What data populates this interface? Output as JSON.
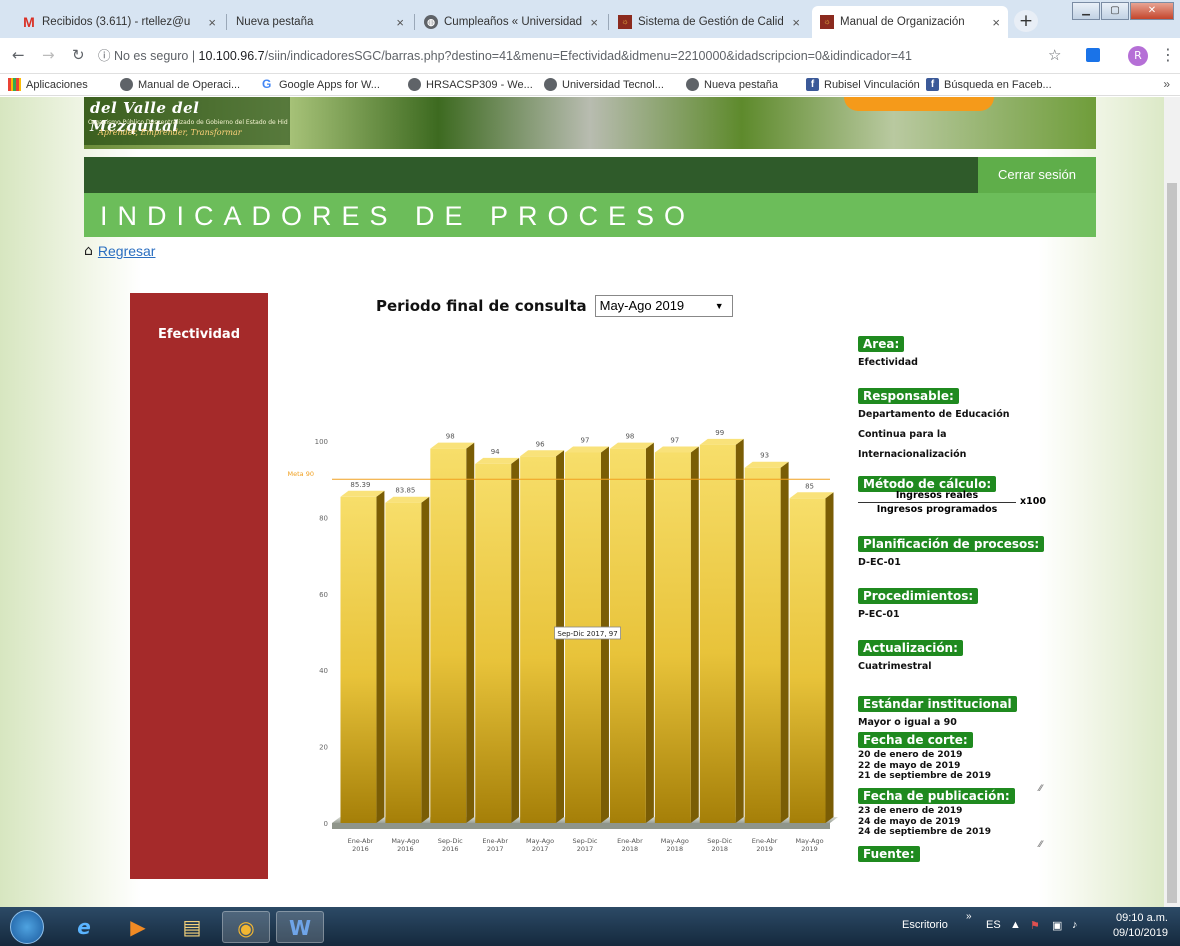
{
  "browser": {
    "tabs": [
      {
        "title": "Recibidos (3.611) - rtellez@u",
        "favicon": "gmail-icon"
      },
      {
        "title": "Nueva pestaña",
        "favicon": "none"
      },
      {
        "title": "Cumpleaños « Universidad T",
        "favicon": "globe-icon"
      },
      {
        "title": "Sistema de Gestión de Calid",
        "favicon": "sgc-icon"
      },
      {
        "title": "Manual de Organización",
        "favicon": "sgc-icon"
      }
    ],
    "tab_close": "×",
    "new_tab": "+",
    "address": {
      "security": "No es seguro",
      "host": "10.100.96.7",
      "path": "/siin/indicadoresSGC/barras.php?destino=41&menu=Efectividad&idmenu=2210000&idadscripcion=0&idindicador=41"
    },
    "profile_initial": "R",
    "bookmarks": [
      "Aplicaciones",
      "Manual de Operaci...",
      "Google Apps for W...",
      "HRSACSP309 - We...",
      "Universidad Tecnol...",
      "Nueva pestaña",
      "Rubisel Vinculación",
      "Búsqueda en Faceb..."
    ],
    "bookmarks_more": "»"
  },
  "page": {
    "logo_main": "del Valle del Mezquital",
    "logo_sub": "Organismo Público Descentralizado de Gobierno del Estado de Hidalgo",
    "logo_tagline": "Aprender, Emprender, Transformar",
    "logout": "Cerrar sesión",
    "title": "INDICADORES DE PROCESO",
    "back_link": "Regresar",
    "side_label": "Efectividad",
    "period_label": "Periodo final de consulta",
    "period_selected": "May-Ago 2019"
  },
  "info": {
    "area_label": "Area:",
    "area_value": "Efectividad",
    "responsable_label": "Responsable:",
    "responsable_lines": [
      "Departamento de Educación",
      "Continua para la",
      "Internacionalización"
    ],
    "metodo_label": "Método de cálculo:",
    "metodo_num": "Ingresos reales",
    "metodo_den": "Ingresos programados",
    "metodo_factor": "x100",
    "planificacion_label": "Planificación de procesos:",
    "planificacion_value": "D-EC-01",
    "procedimientos_label": "Procedimientos:",
    "procedimientos_value": "P-EC-01",
    "actualizacion_label": "Actualización:",
    "actualizacion_value": "Cuatrimestral",
    "estandar_label": "Estándar institucional",
    "estandar_value": "Mayor o igual a 90",
    "corte_label": "Fecha de corte:",
    "corte_lines": [
      "20 de enero de 2019",
      "22 de mayo de 2019",
      "21 de septiembre de 2019"
    ],
    "publicacion_label": "Fecha de publicación:",
    "publicacion_lines": [
      "23 de enero de 2019",
      "24 de mayo de 2019",
      "24 de septiembre de 2019"
    ],
    "fuente_label": "Fuente:"
  },
  "chart_data": {
    "type": "bar",
    "categories": [
      [
        "Ene-Abr",
        "2016"
      ],
      [
        "May-Ago",
        "2016"
      ],
      [
        "Sep-Dic",
        "2016"
      ],
      [
        "Ene-Abr",
        "2017"
      ],
      [
        "May-Ago",
        "2017"
      ],
      [
        "Sep-Dic",
        "2017"
      ],
      [
        "Ene-Abr",
        "2018"
      ],
      [
        "May-Ago",
        "2018"
      ],
      [
        "Sep-Dic",
        "2018"
      ],
      [
        "Ene-Abr",
        "2019"
      ],
      [
        "May-Ago",
        "2019"
      ]
    ],
    "values": [
      85.39,
      83.85,
      98,
      94,
      96,
      97,
      98,
      97,
      99,
      93,
      85
    ],
    "value_labels": [
      "85.39",
      "83.85",
      "98",
      "94",
      "96",
      "97",
      "98",
      "97",
      "99",
      "93",
      "85"
    ],
    "yticks": [
      0,
      20,
      40,
      60,
      80,
      100
    ],
    "ylim": [
      0,
      100
    ],
    "target": {
      "label": "Meta 90",
      "value": 90,
      "color": "#f0a020"
    },
    "tooltip": {
      "text": "Sep-Dic 2017, 97",
      "index": 5
    },
    "bar_color": "#e8c33a",
    "grid": false
  },
  "taskbar": {
    "desktop": "Escritorio",
    "lang": "ES",
    "time": "09:10 a.m.",
    "date": "09/10/2019"
  }
}
